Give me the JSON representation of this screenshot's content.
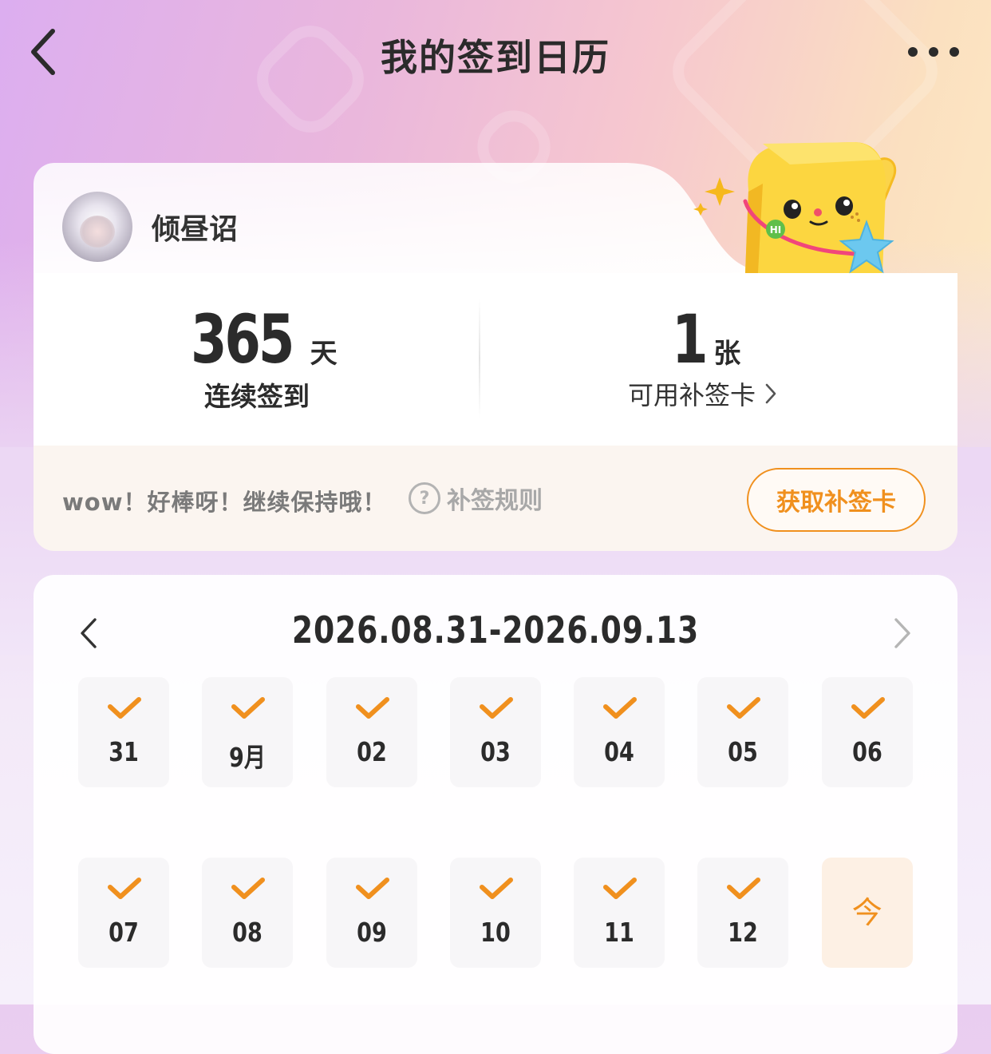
{
  "header": {
    "title": "我的签到日历",
    "back_icon": "chevron-left-icon",
    "more_icon": "more-dots-icon"
  },
  "profile": {
    "username": "倾昼诏",
    "streak": {
      "value": "365",
      "unit": "天",
      "label": "连续签到"
    },
    "cards": {
      "value": "1",
      "unit": "张",
      "label": "可用补签卡"
    },
    "encourage_text": "wow！好棒呀！继续保持哦！",
    "rules_label": "补签规则",
    "get_card_button": "获取补签卡",
    "mascot": {
      "badge": "HI"
    }
  },
  "calendar": {
    "range": "2026.08.31-2026.09.13",
    "days": [
      {
        "label": "31",
        "checked": true
      },
      {
        "label": "9月",
        "checked": true
      },
      {
        "label": "02",
        "checked": true
      },
      {
        "label": "03",
        "checked": true
      },
      {
        "label": "04",
        "checked": true
      },
      {
        "label": "05",
        "checked": true
      },
      {
        "label": "06",
        "checked": true
      },
      {
        "label": "07",
        "checked": true
      },
      {
        "label": "08",
        "checked": true
      },
      {
        "label": "09",
        "checked": true
      },
      {
        "label": "10",
        "checked": true
      },
      {
        "label": "11",
        "checked": true
      },
      {
        "label": "12",
        "checked": true
      },
      {
        "label": "今",
        "checked": false,
        "today": true
      }
    ]
  },
  "colors": {
    "accent": "#f0901e",
    "text": "#2b2b2b",
    "muted": "#a8a8a8"
  }
}
